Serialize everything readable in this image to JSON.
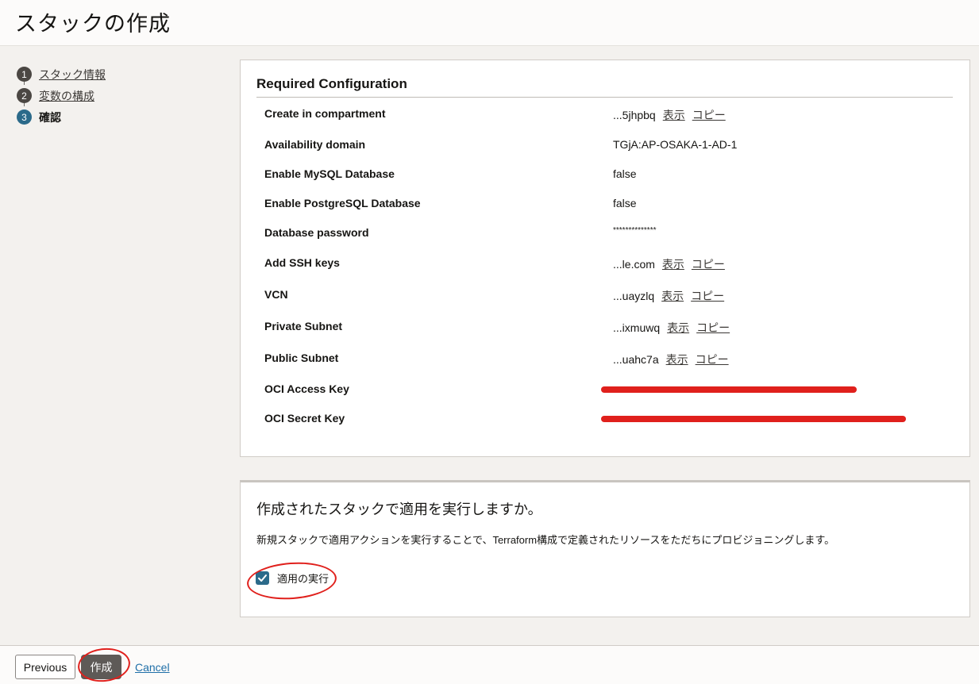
{
  "page": {
    "title": "スタックの作成"
  },
  "steps": [
    {
      "number": "1",
      "label": "スタック情報"
    },
    {
      "number": "2",
      "label": "変数の構成"
    },
    {
      "number": "3",
      "label": "確認"
    }
  ],
  "config": {
    "title": "Required Configuration",
    "show_label": "表示",
    "copy_label": "コピー",
    "rows": [
      {
        "label": "Create in compartment",
        "value": "...5jhpbq"
      },
      {
        "label": "Availability domain",
        "value": "TGjA:AP-OSAKA-1-AD-1"
      },
      {
        "label": "Enable MySQL Database",
        "value": "false"
      },
      {
        "label": "Enable PostgreSQL Database",
        "value": "false"
      },
      {
        "label": "Database password",
        "value": "**************"
      },
      {
        "label": "Add SSH keys",
        "value": "...le.com"
      },
      {
        "label": "VCN",
        "value": "...uayzlq"
      },
      {
        "label": "Private Subnet",
        "value": "...ixmuwq"
      },
      {
        "label": "Public Subnet",
        "value": "...uahc7a"
      },
      {
        "label": "OCI Access Key",
        "value": ""
      },
      {
        "label": "OCI Secret Key",
        "value": ""
      }
    ]
  },
  "apply": {
    "title": "作成されたスタックで適用を実行しますか。",
    "description": "新規スタックで適用アクションを実行することで、Terraform構成で定義されたリソースをただちにプロビジョニングします。",
    "checkbox_label": "適用の実行",
    "checked": true
  },
  "footer": {
    "previous_label": "Previous",
    "create_label": "作成",
    "cancel_label": "Cancel"
  },
  "colors": {
    "accent": "#2b6a8a",
    "annotation": "#e0201c",
    "create_button": "#5e5a57"
  }
}
